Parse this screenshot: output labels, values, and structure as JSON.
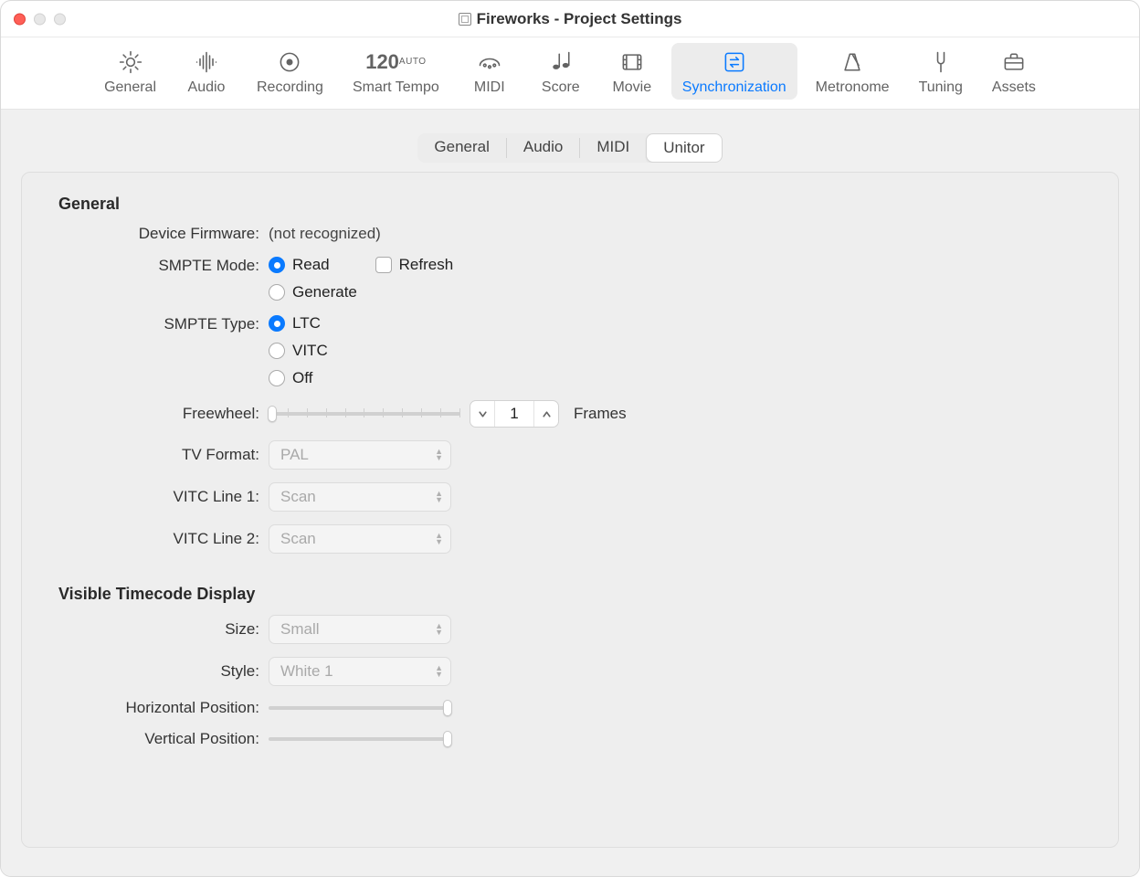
{
  "window": {
    "title": "Fireworks - Project Settings"
  },
  "toolbar": {
    "items": [
      {
        "id": "general",
        "label": "General"
      },
      {
        "id": "audio",
        "label": "Audio"
      },
      {
        "id": "recording",
        "label": "Recording"
      },
      {
        "id": "smart-tempo",
        "label": "Smart Tempo",
        "big": "120",
        "small": "AUTO"
      },
      {
        "id": "midi",
        "label": "MIDI"
      },
      {
        "id": "score",
        "label": "Score"
      },
      {
        "id": "movie",
        "label": "Movie"
      },
      {
        "id": "synchronization",
        "label": "Synchronization",
        "active": true
      },
      {
        "id": "metronome",
        "label": "Metronome"
      },
      {
        "id": "tuning",
        "label": "Tuning"
      },
      {
        "id": "assets",
        "label": "Assets"
      }
    ],
    "active": "synchronization"
  },
  "subtabs": {
    "items": [
      "General",
      "Audio",
      "MIDI",
      "Unitor"
    ],
    "active": "Unitor"
  },
  "sections": {
    "general": {
      "title": "General",
      "labels": {
        "device_firmware": "Device Firmware:",
        "smpte_mode": "SMPTE Mode:",
        "smpte_type": "SMPTE Type:",
        "freewheel": "Freewheel:",
        "tv_format": "TV Format:",
        "vitc_line_1": "VITC Line 1:",
        "vitc_line_2": "VITC Line 2:"
      },
      "device_firmware_value": "(not recognized)",
      "smpte_mode": {
        "options": {
          "read": "Read",
          "generate": "Generate"
        },
        "selected": "read",
        "refresh_label": "Refresh",
        "refresh_checked": false
      },
      "smpte_type": {
        "options": {
          "ltc": "LTC",
          "vitc": "VITC",
          "off": "Off"
        },
        "selected": "ltc"
      },
      "freewheel": {
        "value": "1",
        "unit": "Frames"
      },
      "tv_format": {
        "value": "PAL"
      },
      "vitc_line_1": {
        "value": "Scan"
      },
      "vitc_line_2": {
        "value": "Scan"
      }
    },
    "visible_timecode": {
      "title": "Visible Timecode Display",
      "labels": {
        "size": "Size:",
        "style": "Style:",
        "horizontal_position": "Horizontal Position:",
        "vertical_position": "Vertical Position:"
      },
      "size": {
        "value": "Small"
      },
      "style": {
        "value": "White 1"
      }
    }
  }
}
